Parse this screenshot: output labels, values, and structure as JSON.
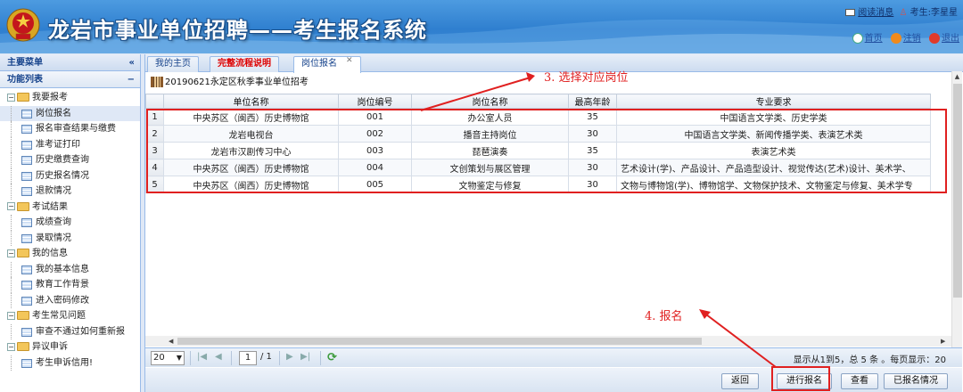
{
  "header": {
    "title": "龙岩市事业单位招聘——考生报名系统",
    "message_link": "阅读消息",
    "user_label": "考生:李星星",
    "links": [
      "首页",
      "注销",
      "退出"
    ]
  },
  "sidebar": {
    "main_menu_title": "主要菜单",
    "function_list_title": "功能列表",
    "collapse_symbol": "«",
    "minus_symbol": "−",
    "groups": [
      {
        "label": "我要报考",
        "items": [
          "岗位报名",
          "报名审查结果与缴费",
          "准考证打印",
          "历史缴费查询",
          "历史报名情况",
          "退款情况"
        ]
      },
      {
        "label": "考试结果",
        "items": [
          "成绩查询",
          "录取情况"
        ]
      },
      {
        "label": "我的信息",
        "items": [
          "我的基本信息",
          "教育工作背景",
          "进入密码修改"
        ]
      },
      {
        "label": "考生常见问题",
        "items": [
          "审查不通过如何重新报"
        ]
      },
      {
        "label": "异议申诉",
        "items": [
          "考生申诉信用!"
        ]
      }
    ],
    "selected_item": "岗位报名"
  },
  "tabs": [
    {
      "label": "我的主页",
      "active": false,
      "highlight": false
    },
    {
      "label": "完整流程说明",
      "active": false,
      "highlight": true
    },
    {
      "label": "岗位报名",
      "active": true,
      "highlight": false,
      "closable": true
    }
  ],
  "grid": {
    "title": "20190621永定区秋季事业单位招考",
    "columns": [
      "单位名称",
      "岗位编号",
      "岗位名称",
      "最高年龄",
      "专业要求"
    ],
    "rows": [
      {
        "n": "1",
        "unit": "中央苏区（闽西）历史博物馆",
        "code": "001",
        "post": "办公室人员",
        "age": "35",
        "major": "中国语言文学类、历史学类"
      },
      {
        "n": "2",
        "unit": "龙岩电视台",
        "code": "002",
        "post": "播音主持岗位",
        "age": "30",
        "major": "中国语言文学类、新闻传播学类、表演艺术类"
      },
      {
        "n": "3",
        "unit": "龙岩市汉剧传习中心",
        "code": "003",
        "post": "琵琶演奏",
        "age": "35",
        "major": "表演艺术类"
      },
      {
        "n": "4",
        "unit": "中央苏区（闽西）历史博物馆",
        "code": "004",
        "post": "文创策划与展区管理",
        "age": "30",
        "major": "艺术设计(学)、产品设计、产品造型设计、视觉传达(艺术)设计、美术学、"
      },
      {
        "n": "5",
        "unit": "中央苏区（闽西）历史博物馆",
        "code": "005",
        "post": "文物鉴定与修复",
        "age": "30",
        "major": "文物与博物馆(学)、博物馆学、文物保护技术、文物鉴定与修复、美术学专"
      }
    ]
  },
  "pager": {
    "page_size": "20",
    "page_value": "1",
    "page_total": "/ 1",
    "info": "显示从1到5，总 5 条 。每页显示：20"
  },
  "buttons": {
    "back": "返回",
    "apply": "进行报名",
    "view": "查看",
    "history": "已报名情况"
  },
  "annotations": {
    "step3": "3. 选择对应岗位",
    "step4": "4. 报名",
    "color": "#e02020"
  }
}
